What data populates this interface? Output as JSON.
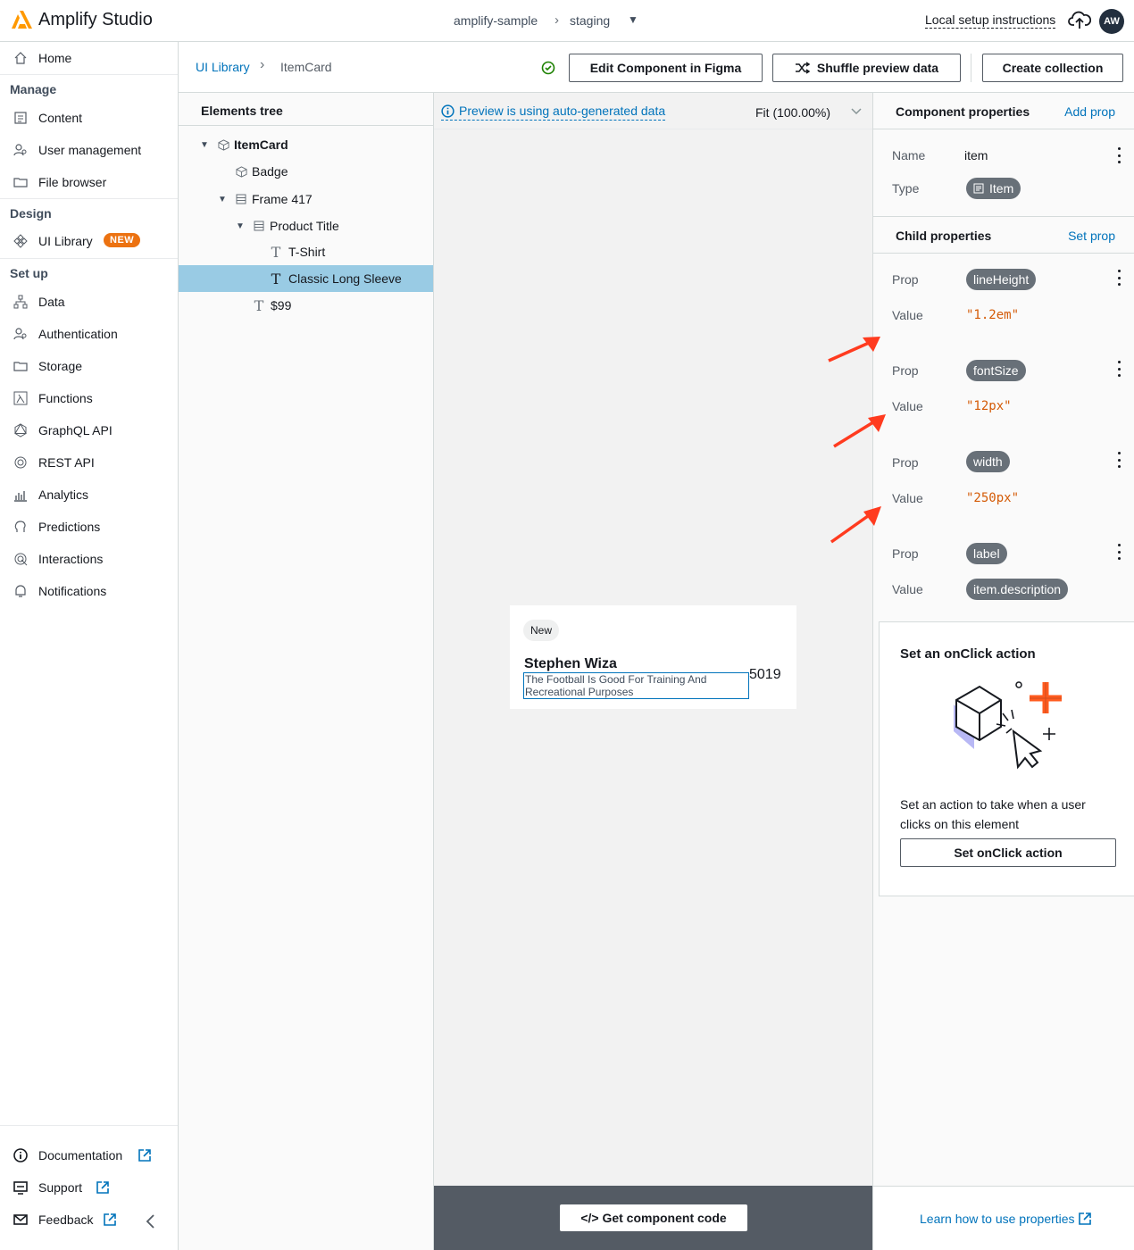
{
  "topbar": {
    "app_title": "Amplify Studio",
    "app_name": "amplify-sample",
    "environment": "staging",
    "local_setup": "Local setup instructions",
    "avatar_initials": "AW"
  },
  "sidebar": {
    "home": "Home",
    "manage_heading": "Manage",
    "manage_items": [
      "Content",
      "User management",
      "File browser"
    ],
    "design_heading": "Design",
    "ui_library": "UI Library",
    "new_badge": "NEW",
    "setup_heading": "Set up",
    "setup_items": [
      "Data",
      "Authentication",
      "Storage",
      "Functions",
      "GraphQL API",
      "REST API",
      "Analytics",
      "Predictions",
      "Interactions",
      "Notifications"
    ],
    "footer_items": [
      "Documentation",
      "Support",
      "Feedback"
    ]
  },
  "header": {
    "breadcrumb_root": "UI Library",
    "breadcrumb_current": "ItemCard",
    "edit_figma": "Edit Component in Figma",
    "shuffle": "Shuffle preview data",
    "create_collection": "Create collection"
  },
  "tree": {
    "title": "Elements tree",
    "nodes": [
      "ItemCard",
      "Badge",
      "Frame 417",
      "Product Title",
      "T-Shirt",
      "Classic Long Sleeve",
      "$99"
    ]
  },
  "canvas": {
    "preview_note": "Preview is using auto-generated data",
    "fit": "Fit (100.00%)",
    "card_badge": "New",
    "card_name": "Stephen Wiza",
    "card_desc": "The Football Is Good For Training And Recreational Purposes",
    "card_price": "5019",
    "get_code": "</> Get component code"
  },
  "props": {
    "component_title": "Component properties",
    "add_prop": "Add prop",
    "name_label": "Name",
    "name_value": "item",
    "type_label": "Type",
    "type_value": "Item",
    "child_title": "Child properties",
    "set_prop": "Set prop",
    "prop_label": "Prop",
    "value_label": "Value",
    "child_props": [
      {
        "prop": "lineHeight",
        "value": "\"1.2em\""
      },
      {
        "prop": "fontSize",
        "value": "\"12px\""
      },
      {
        "prop": "width",
        "value": "\"250px\""
      },
      {
        "prop": "label",
        "value": "item.description"
      }
    ],
    "onclick_title": "Set an onClick action",
    "onclick_desc": "Set an action to take when a user clicks on this element",
    "onclick_btn": "Set onClick action",
    "learn_link": "Learn how to use properties"
  },
  "colors": {
    "link": "#0073bb",
    "accent": "#ec7211",
    "selected_row": "#99cbe4",
    "code_value": "#d45b07",
    "pill": "#687078",
    "arrow": "#ff3b1f"
  }
}
